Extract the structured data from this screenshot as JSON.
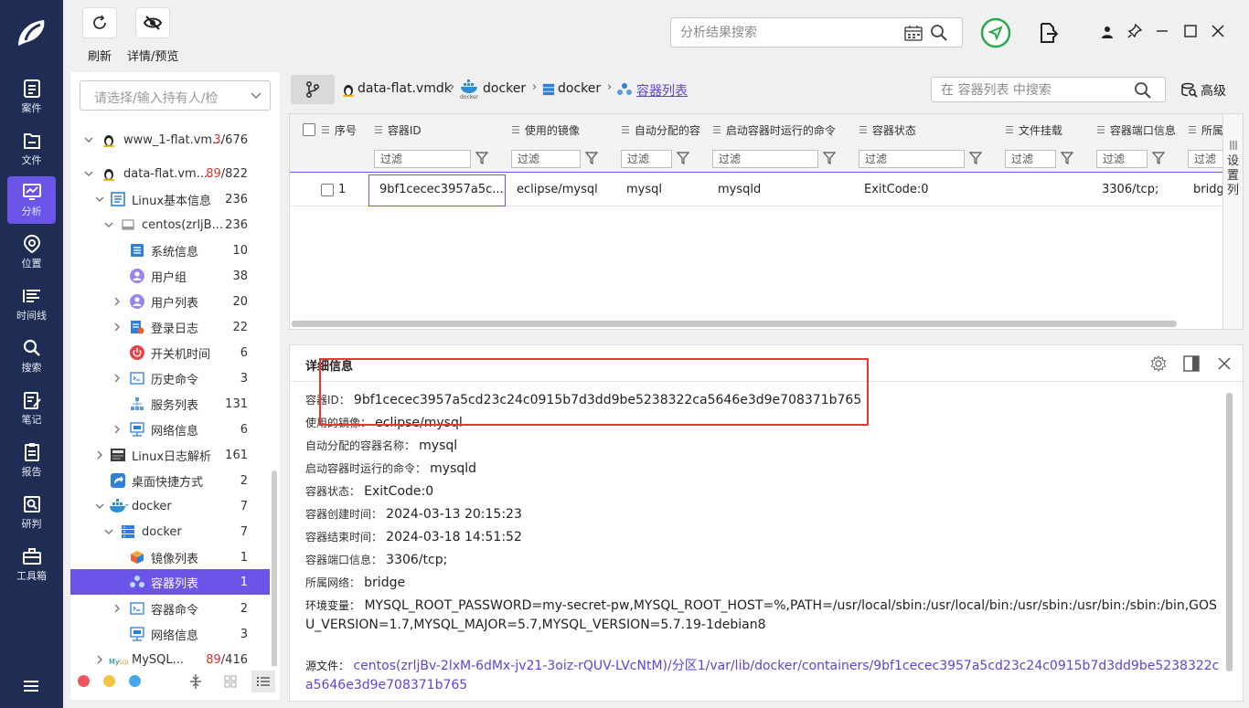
{
  "toolbar": {
    "refresh_label": "刷新",
    "details_label": "详情/预览",
    "search_placeholder": "分析结果搜索"
  },
  "nav": {
    "items": [
      {
        "label": "案件",
        "icon": "case-icon"
      },
      {
        "label": "文件",
        "icon": "folder-icon"
      },
      {
        "label": "分析",
        "icon": "analysis-icon"
      },
      {
        "label": "位置",
        "icon": "location-icon"
      },
      {
        "label": "时间线",
        "icon": "timeline-icon"
      },
      {
        "label": "搜索",
        "icon": "search-icon"
      },
      {
        "label": "笔记",
        "icon": "notes-icon"
      },
      {
        "label": "报告",
        "icon": "report-icon"
      },
      {
        "label": "研判",
        "icon": "research-icon"
      },
      {
        "label": "工具箱",
        "icon": "toolbox-icon"
      }
    ],
    "active_index": 2
  },
  "tree": {
    "select_placeholder": "请选择/输入持有人/检",
    "rows": [
      {
        "label": "www_1-flat.vm...",
        "count_red": "3",
        "count_total": "/676"
      },
      {
        "label": "data-flat.vm...",
        "count_red": "89",
        "count_total": "/822"
      },
      {
        "label": "Linux基本信息",
        "count": "236"
      },
      {
        "label": "centos(zrljB...",
        "count": "236"
      },
      {
        "label": "系统信息",
        "count": "10"
      },
      {
        "label": "用户组",
        "count": "38"
      },
      {
        "label": "用户列表",
        "count": "20"
      },
      {
        "label": "登录日志",
        "count": "22"
      },
      {
        "label": "开关机时间",
        "count": "6"
      },
      {
        "label": "历史命令",
        "count": "3"
      },
      {
        "label": "服务列表",
        "count": "131"
      },
      {
        "label": "网络信息",
        "count": "6"
      },
      {
        "label": "Linux日志解析",
        "count": "161"
      },
      {
        "label": "桌面快捷方式",
        "count": "2"
      },
      {
        "label": "docker",
        "count": "7"
      },
      {
        "label": "docker",
        "count": "7"
      },
      {
        "label": "镜像列表",
        "count": "1"
      },
      {
        "label": "容器列表",
        "count": "1"
      },
      {
        "label": "容器命令",
        "count": "2"
      },
      {
        "label": "网络信息",
        "count": "3"
      },
      {
        "label": "MySQL...",
        "count_red": "89",
        "count_total": "/416"
      }
    ]
  },
  "breadcrumb": {
    "items": [
      "data-flat.vmdk",
      "docker",
      "docker",
      "容器列表"
    ],
    "search_placeholder": "在 容器列表 中搜索",
    "advanced_label": "高级"
  },
  "grid": {
    "columns": [
      "序号",
      "容器ID",
      "使用的镜像",
      "自动分配的容",
      "启动容器时运行的命令",
      "容器状态",
      "文件挂载",
      "容器端口信息",
      "所属"
    ],
    "filter_label": "过滤",
    "rows": [
      {
        "index": "1",
        "id": "9bf1cecec3957a5c...",
        "image": "eclipse/mysql",
        "name": "mysql",
        "command": "mysqld",
        "status": "ExitCode:0",
        "mount": "",
        "port": "3306/tcp;",
        "network": "bridg"
      }
    ],
    "settings_label": "设置列"
  },
  "detail": {
    "title": "详细信息",
    "fields": [
      {
        "key": "容器ID：",
        "value": "9bf1cecec3957a5cd23c24c0915b7d3dd9be5238322ca5646e3d9e708371b765"
      },
      {
        "key": "使用的镜像：",
        "value": "eclipse/mysql"
      },
      {
        "key": "自动分配的容器名称：",
        "value": "mysql"
      },
      {
        "key": "启动容器时运行的命令：",
        "value": "mysqld"
      },
      {
        "key": "容器状态：",
        "value": "ExitCode:0"
      },
      {
        "key": "容器创建时间：",
        "value": "2024-03-13 20:15:23"
      },
      {
        "key": "容器结束时间：",
        "value": "2024-03-18 14:51:52"
      },
      {
        "key": "容器端口信息：",
        "value": "3306/tcp;"
      },
      {
        "key": "所属网络：",
        "value": "bridge"
      }
    ],
    "env_key": "环境变量：",
    "env_value": "MYSQL_ROOT_PASSWORD=my-secret-pw,MYSQL_ROOT_HOST=%,PATH=/usr/local/sbin:/usr/local/bin:/usr/sbin:/usr/bin:/sbin:/bin,GOSU_VERSION=1.7,MYSQL_MAJOR=5.7,MYSQL_VERSION=5.7.19-1debian8",
    "source_key": "源文件：",
    "source_value": "centos(zrljBv-2lxM-6dMx-jv21-3oiz-rQUV-LVcNtM)/分区1/var/lib/docker/containers/9bf1cecec3957a5cd23c24c0915b7d3dd9be5238322ca5646e3d9e708371b765"
  },
  "colors": {
    "accent": "#6a55e8",
    "nav_bg": "#1f2d54",
    "highlight_box": "#e53935",
    "count_red": "#d9342b",
    "dot_red": "#f0545c",
    "dot_yellow": "#f5c242",
    "dot_blue": "#47a7f0"
  }
}
